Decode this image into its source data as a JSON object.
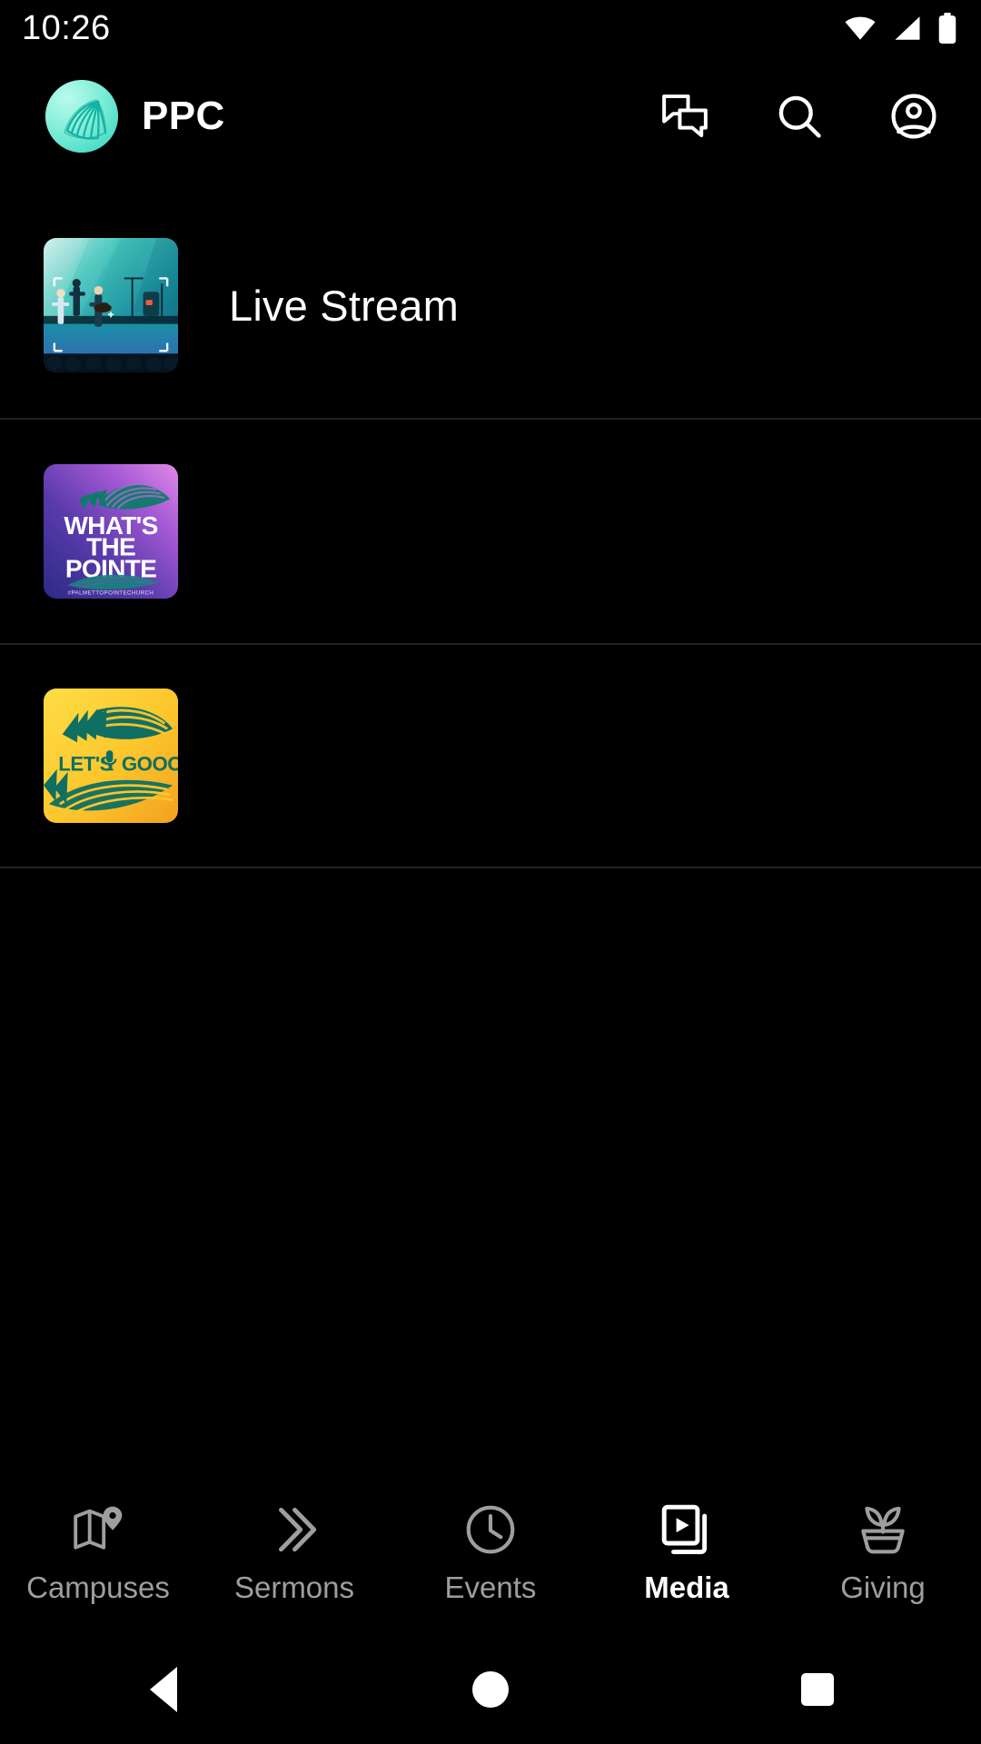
{
  "status_bar": {
    "time": "10:26",
    "icons": [
      "wifi-icon",
      "cell-signal-icon",
      "battery-icon"
    ]
  },
  "app_bar": {
    "logo_icon": "palmetto-frond-logo",
    "title": "PPC",
    "actions": [
      {
        "icon": "chat-bubbles-icon",
        "name": "messages-button"
      },
      {
        "icon": "search-icon",
        "name": "search-button"
      },
      {
        "icon": "account-circle-icon",
        "name": "account-button"
      }
    ]
  },
  "media_list": {
    "items": [
      {
        "title": "Live Stream",
        "thumbnail": "live-stream-stage-photo",
        "thumb_colors": {
          "sky": "#2fc6bd",
          "stage": "#1f86a8",
          "floor": "#2a6fa8"
        }
      },
      {
        "title": "",
        "thumbnail": "whats-the-pointe-artwork",
        "artwork_text": {
          "line1": "WHAT'S",
          "line2": "THE",
          "line3": "POINTE",
          "hashtag": "#PALMETTOPOINTECHURCH"
        },
        "thumb_colors": {
          "grad_start": "#3b2c8f",
          "grad_end": "#d67ce8",
          "frond": "#127a6e"
        }
      },
      {
        "title": "",
        "thumbnail": "lets-goooo-artwork",
        "artwork_text": {
          "line1": "LET'S",
          "line2": "GOOOO!"
        },
        "thumb_colors": {
          "grad_start": "#ffd83d",
          "grad_end": "#f5a623",
          "frond": "#0f6f62"
        }
      }
    ]
  },
  "tab_bar": {
    "tabs": [
      {
        "label": "Campuses",
        "icon": "map-pin-icon",
        "active": false
      },
      {
        "label": "Sermons",
        "icon": "double-chevron-right-icon",
        "active": false
      },
      {
        "label": "Events",
        "icon": "clock-icon",
        "active": false
      },
      {
        "label": "Media",
        "icon": "video-library-icon",
        "active": true
      },
      {
        "label": "Giving",
        "icon": "sprout-pot-icon",
        "active": false
      }
    ],
    "active_color": "#ffffff",
    "inactive_color": "#9e9e9e"
  },
  "system_nav": {
    "buttons": [
      {
        "name": "back-button",
        "icon": "triangle-back-icon"
      },
      {
        "name": "home-button",
        "icon": "circle-home-icon"
      },
      {
        "name": "recents-button",
        "icon": "square-recents-icon"
      }
    ]
  },
  "theme": {
    "background": "#000000",
    "divider": "#222222",
    "accent": "#5fe3cd"
  }
}
